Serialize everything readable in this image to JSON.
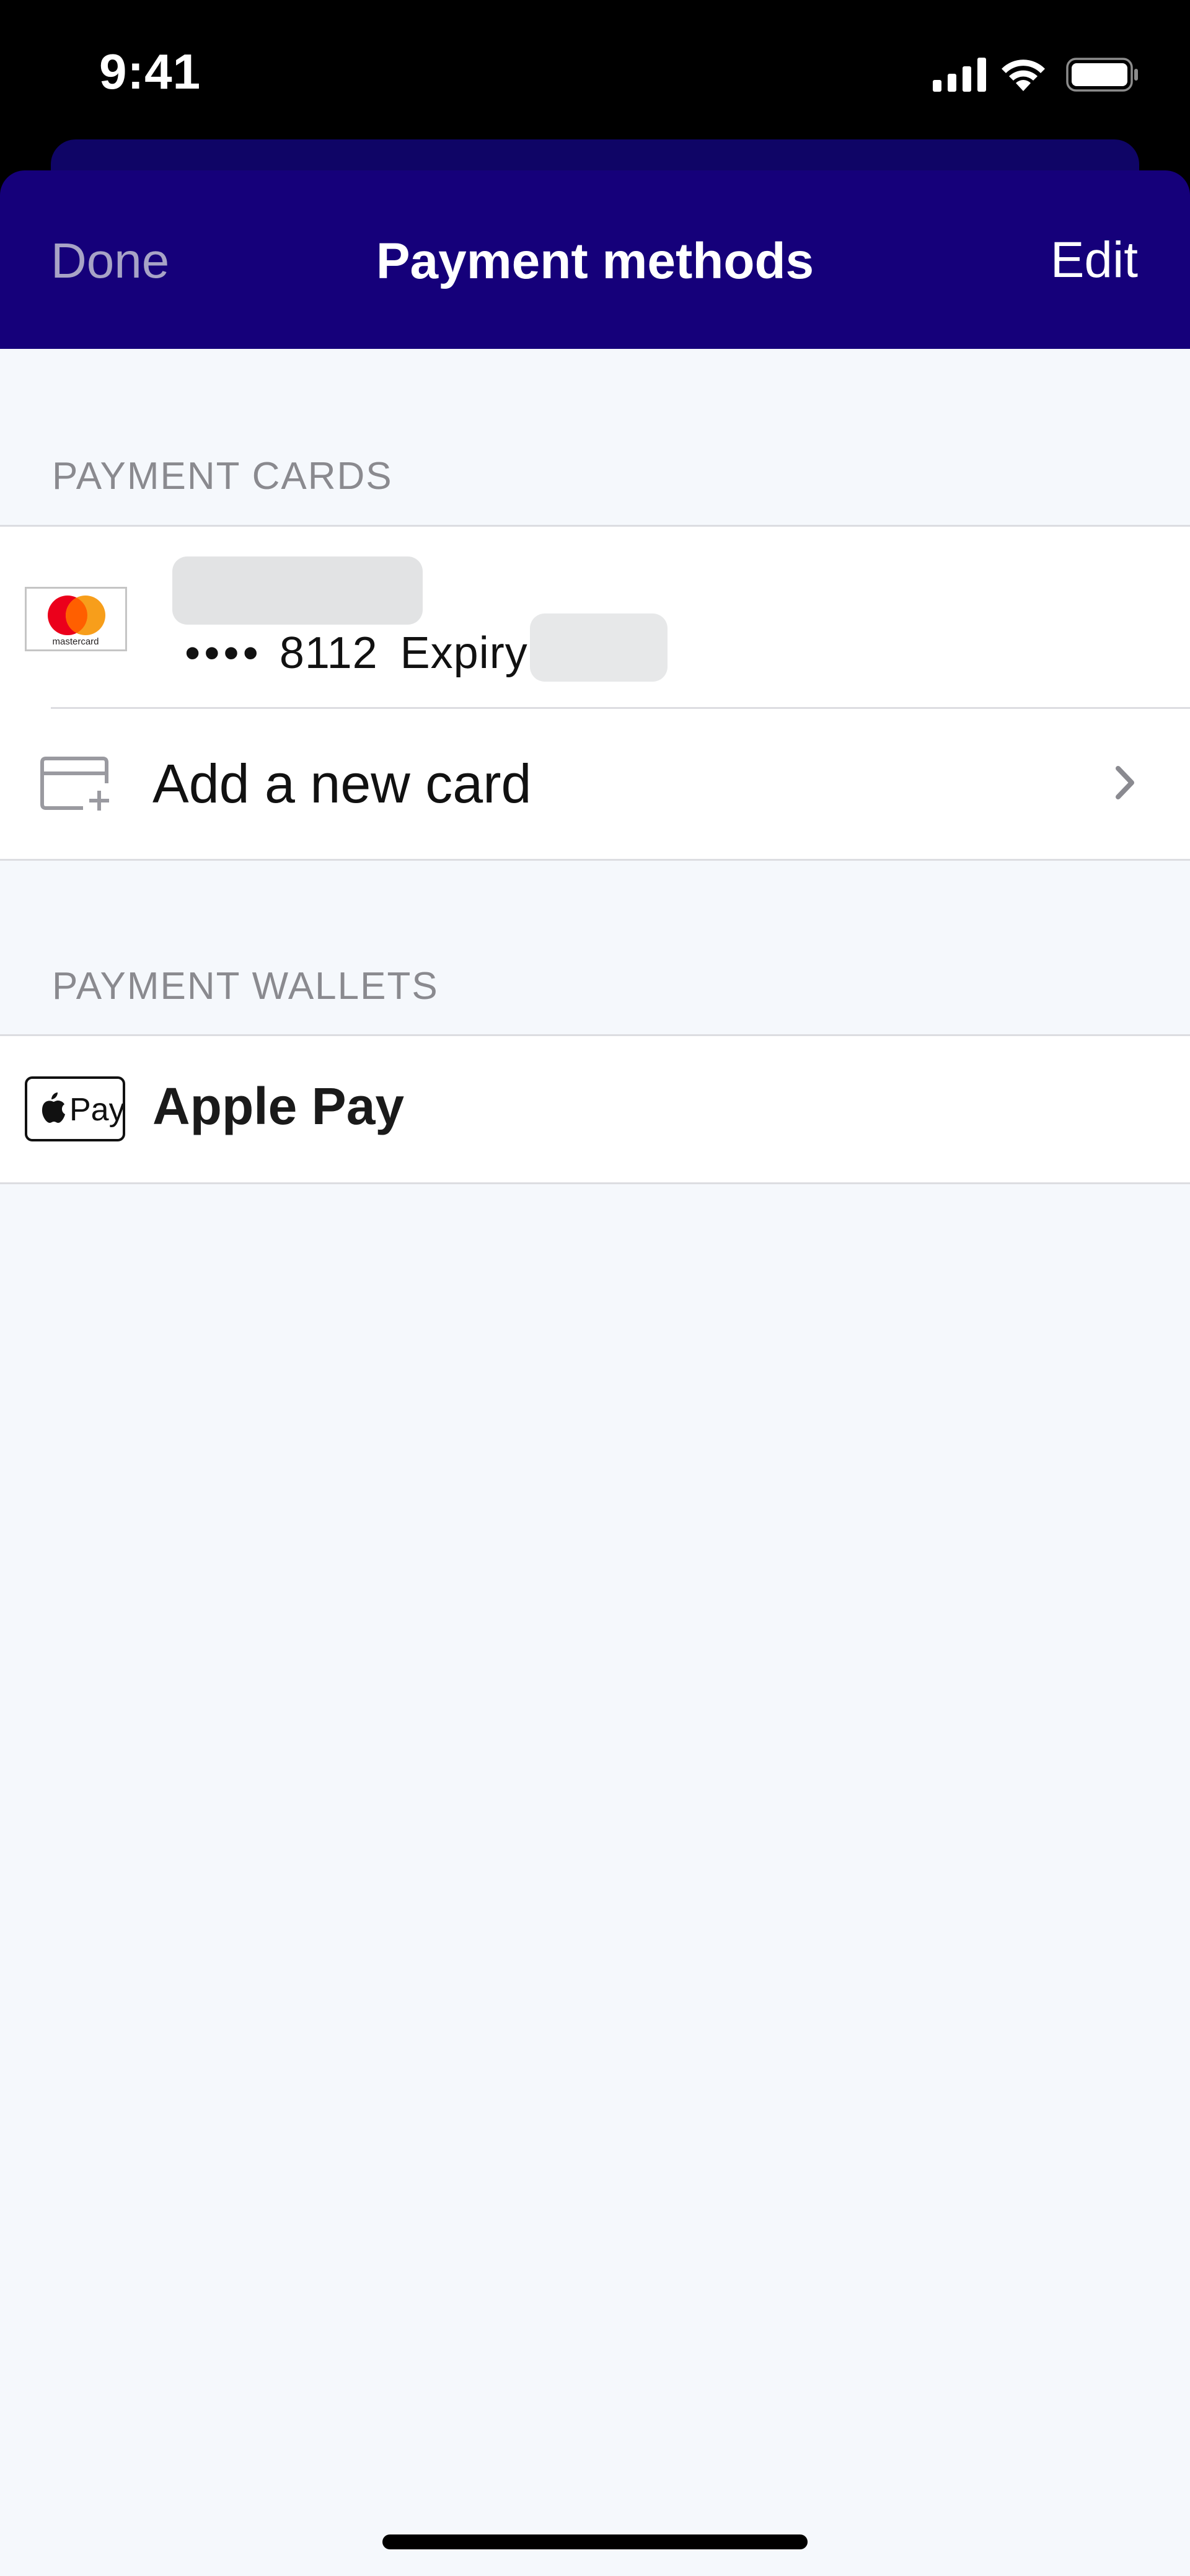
{
  "status_bar": {
    "time": "9:41",
    "icons": [
      "cellular-signal-icon",
      "wifi-icon",
      "battery-icon"
    ]
  },
  "nav": {
    "done_label": "Done",
    "title": "Payment methods",
    "edit_label": "Edit"
  },
  "payment_cards": {
    "header": "PAYMENT CARDS",
    "cards": [
      {
        "brand_icon": "mastercard-logo-icon",
        "brand_text": "mastercard",
        "masked_dots": "••••",
        "last4": "8112",
        "expiry_label": "Expiry"
      }
    ],
    "add_card_label": "Add a new card",
    "add_card_icon": "add-card-icon"
  },
  "payment_wallets": {
    "header": "PAYMENT WALLETS",
    "items": [
      {
        "logo_text": "Pay",
        "label": "Apple Pay",
        "icon": "apple-pay-logo-icon"
      }
    ]
  },
  "colors": {
    "nav_background": "#15007a",
    "nav_done_text": "#a7a3c6",
    "content_background": "#f5f8fc",
    "mastercard_red": "#eb001b",
    "mastercard_orange": "#f79e1b"
  }
}
